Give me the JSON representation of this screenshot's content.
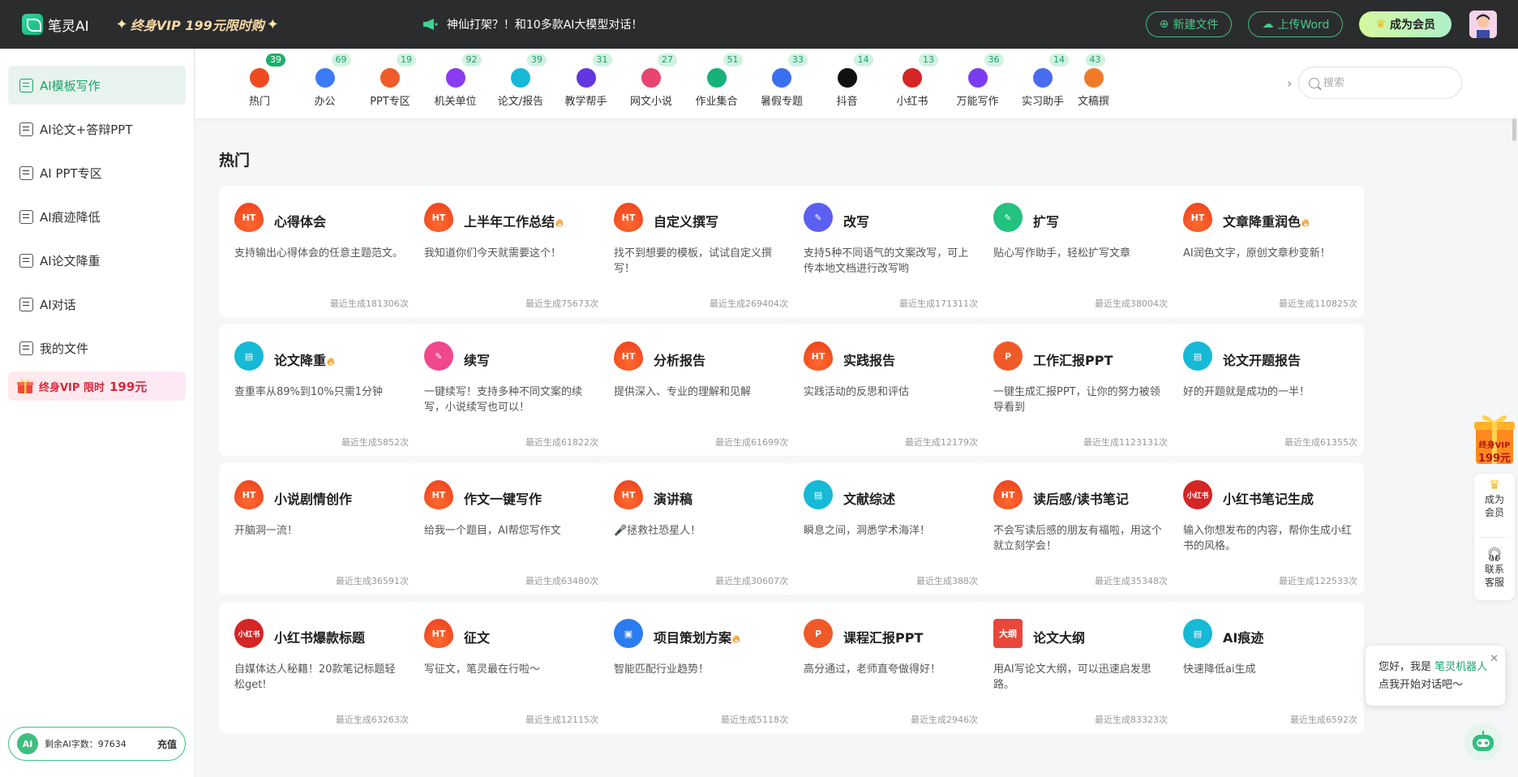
{
  "topbar": {
    "logo_text": "笔灵AI",
    "vip_promo": "终身VIP 199元限时购",
    "announcement": "神仙打架？！和10多款AI大模型对话！",
    "new_file_label": "新建文件",
    "upload_word_label": "上传Word",
    "member_label": "成为会员"
  },
  "sidebar": {
    "items": [
      {
        "label": "AI模板写作"
      },
      {
        "label": "AI论文+答辩PPT"
      },
      {
        "label": "AI PPT专区"
      },
      {
        "label": "AI痕迹降低"
      },
      {
        "label": "AI论文降重"
      },
      {
        "label": "AI对话"
      },
      {
        "label": "我的文件"
      }
    ],
    "vip_banner_text": "终身VIP 限时",
    "vip_banner_price": "199元",
    "ai_badge": "AI",
    "remaining_label": "剩余AI字数：",
    "remaining_value": "97634",
    "recharge_label": "充值"
  },
  "categories": [
    {
      "label": "热门",
      "count": "39",
      "color": "#f04a21",
      "icon": "flame-icon"
    },
    {
      "label": "办公",
      "count": "69",
      "color": "#3a7bf6",
      "icon": "briefcase-icon"
    },
    {
      "label": "PPT专区",
      "count": "19",
      "color": "#f05a28",
      "icon": "ppt-icon"
    },
    {
      "label": "机关单位",
      "count": "92",
      "color": "#8a3cf0",
      "icon": "badge-icon"
    },
    {
      "label": "论文/报告",
      "count": "39",
      "color": "#16b9d6",
      "icon": "report-icon"
    },
    {
      "label": "教学帮手",
      "count": "31",
      "color": "#6236e0",
      "icon": "graduation-cap-icon"
    },
    {
      "label": "网文小说",
      "count": "27",
      "color": "#e8456f",
      "icon": "novel-icon"
    },
    {
      "label": "作业集合",
      "count": "51",
      "color": "#16b27a",
      "icon": "homework-icon"
    },
    {
      "label": "暑假专题",
      "count": "33",
      "color": "#3a6ff0",
      "icon": "summer-icon"
    },
    {
      "label": "抖音",
      "count": "14",
      "color": "#111111",
      "icon": "douyin-icon"
    },
    {
      "label": "小红书",
      "count": "13",
      "color": "#d52525",
      "icon": "xiaohongshu-icon"
    },
    {
      "label": "万能写作",
      "count": "36",
      "color": "#7a3cf0",
      "icon": "writing-icon"
    },
    {
      "label": "实习助手",
      "count": "14",
      "color": "#4a6cf0",
      "icon": "intern-icon"
    },
    {
      "label": "文稿撰",
      "count": "43",
      "color": "#f07a28",
      "icon": "document-icon"
    }
  ],
  "search": {
    "placeholder": "搜索"
  },
  "section_title": "热门",
  "cards": [
    {
      "title": "心得体会",
      "desc": "支持输出心得体会的任意主题范文。",
      "stat": "最近生成181306次",
      "icon": "flame",
      "icon_text": "HT",
      "color": "#f04a21",
      "hot": false
    },
    {
      "title": "上半年工作总结",
      "desc": "我知道你们今天就需要这个！",
      "stat": "最近生成75673次",
      "icon": "flame",
      "icon_text": "HT",
      "color": "#f04a21",
      "hot": true
    },
    {
      "title": "自定义撰写",
      "desc": "找不到想要的模板，试试自定义撰写！",
      "stat": "最近生成269404次",
      "icon": "flame",
      "icon_text": "HT",
      "color": "#f04a21",
      "hot": false
    },
    {
      "title": "改写",
      "desc": "支持5种不同语气的文案改写，可上传本地文档进行改写哟",
      "stat": "最近生成171311次",
      "icon": "rewrite",
      "icon_text": "✎",
      "color": "#5b5ff2",
      "hot": false
    },
    {
      "title": "扩写",
      "desc": "贴心写作助手，轻松扩写文章",
      "stat": "最近生成38004次",
      "icon": "expand",
      "icon_text": "✎",
      "color": "#22c27f",
      "hot": false
    },
    {
      "title": "文章降重润色",
      "desc": "AI润色文字，原创文章秒变新！",
      "stat": "最近生成110825次",
      "icon": "flame",
      "icon_text": "HT",
      "color": "#f04a21",
      "hot": true
    },
    {
      "title": "论文降重",
      "desc": "查重率从89%到10%只需1分钟",
      "stat": "最近生成5852次",
      "icon": "paper",
      "icon_text": "▤",
      "color": "#16b9d6",
      "hot": true
    },
    {
      "title": "续写",
      "desc": "一键续写！支持多种不同文案的续写，小说续写也可以！",
      "stat": "最近生成61822次",
      "icon": "continue",
      "icon_text": "✎",
      "color": "#f0478d",
      "hot": false
    },
    {
      "title": "分析报告",
      "desc": "提供深入、专业的理解和见解",
      "stat": "最近生成61699次",
      "icon": "flame",
      "icon_text": "HT",
      "color": "#f04a21",
      "hot": false
    },
    {
      "title": "实践报告",
      "desc": "实践活动的反思和评估",
      "stat": "最近生成12179次",
      "icon": "flame",
      "icon_text": "HT",
      "color": "#f04a21",
      "hot": false
    },
    {
      "title": "工作汇报PPT",
      "desc": "一键生成汇报PPT，让你的努力被领导看到",
      "stat": "最近生成1123131次",
      "icon": "ppt",
      "icon_text": "P",
      "color": "#f05a28",
      "hot": false
    },
    {
      "title": "论文开题报告",
      "desc": "好的开题就是成功的一半！",
      "stat": "最近生成61355次",
      "icon": "paper",
      "icon_text": "▤",
      "color": "#16b9d6",
      "hot": false
    },
    {
      "title": "小说剧情创作",
      "desc": "开脑洞一流！",
      "stat": "最近生成36591次",
      "icon": "flame",
      "icon_text": "HT",
      "color": "#f04a21",
      "hot": false
    },
    {
      "title": "作文一键写作",
      "desc": "给我一个题目，AI帮您写作文",
      "stat": "最近生成63480次",
      "icon": "flame",
      "icon_text": "HT",
      "color": "#f04a21",
      "hot": false
    },
    {
      "title": "演讲稿",
      "desc": "🎤拯救社恐星人！",
      "stat": "最近生成30607次",
      "icon": "flame",
      "icon_text": "HT",
      "color": "#f04a21",
      "hot": false
    },
    {
      "title": "文献综述",
      "desc": "瞬息之间，洞悉学术海洋！",
      "stat": "最近生成388次",
      "icon": "paper",
      "icon_text": "▤",
      "color": "#16b9d6",
      "hot": false
    },
    {
      "title": "读后感/读书笔记",
      "desc": "不会写读后感的朋友有福啦，用这个就立刻学会！",
      "stat": "最近生成35348次",
      "icon": "flame",
      "icon_text": "HT",
      "color": "#f04a21",
      "hot": false
    },
    {
      "title": "小红书笔记生成",
      "desc": "输入你想发布的内容，帮你生成小红书的风格。",
      "stat": "最近生成122533次",
      "icon": "xhs",
      "icon_text": "小红书",
      "color": "#d52525",
      "hot": false
    },
    {
      "title": "小红书爆款标题",
      "desc": "自媒体达人秘籍！20款笔记标题轻松get!",
      "stat": "最近生成63263次",
      "icon": "xhs",
      "icon_text": "小红书",
      "color": "#d52525",
      "hot": false
    },
    {
      "title": "征文",
      "desc": "写征文，笔灵最在行啦～",
      "stat": "最近生成12115次",
      "icon": "flame",
      "icon_text": "HT",
      "color": "#f04a21",
      "hot": false
    },
    {
      "title": "项目策划方案",
      "desc": "智能匹配行业趋势！",
      "stat": "最近生成5118次",
      "icon": "briefcase",
      "icon_text": "▣",
      "color": "#2a7cf0",
      "hot": true
    },
    {
      "title": "课程汇报PPT",
      "desc": "高分通过，老师直夸做得好！",
      "stat": "最近生成2946次",
      "icon": "ppt",
      "icon_text": "P",
      "color": "#f05a28",
      "hot": false
    },
    {
      "title": "论文大纲",
      "desc": "用AI写论文大纲，可以迅速启发思路。",
      "stat": "最近生成83323次",
      "icon": "outline",
      "icon_text": "大纲",
      "color": "#e8473a",
      "hot": false
    },
    {
      "title": "AI痕迹",
      "desc": "快速降低ai生成",
      "stat": "最近生成6592次",
      "icon": "paper",
      "icon_text": "▤",
      "color": "#16b9d6",
      "hot": false
    }
  ],
  "float": {
    "vip_text": "终身VIP",
    "vip_price": "199元",
    "member_label": "成为会员",
    "service_label": "联系客服"
  },
  "chat": {
    "greeting_prefix": "您好，我是 ",
    "bot_name": "笔灵机器人",
    "line2": "点我开始对话吧～"
  }
}
